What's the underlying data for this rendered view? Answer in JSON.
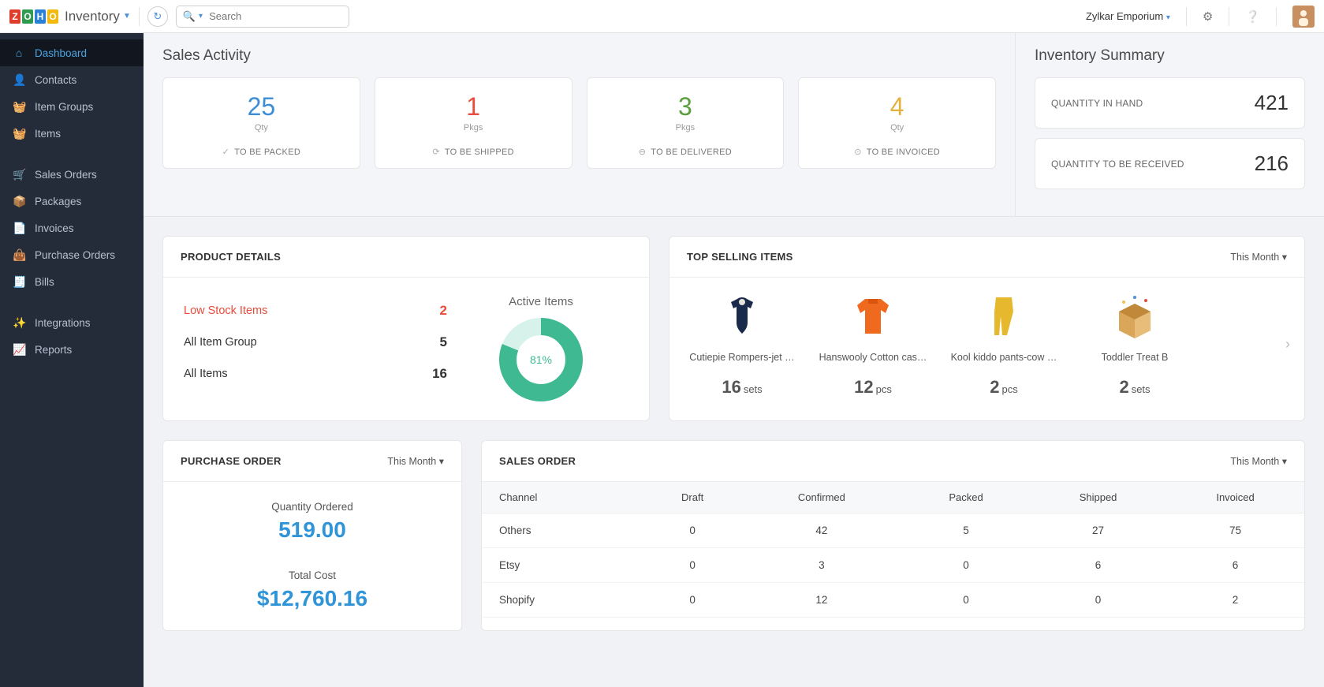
{
  "header": {
    "app_name": "Inventory",
    "search_placeholder": "Search",
    "org_name": "Zylkar Emporium"
  },
  "sidebar": {
    "items": [
      {
        "label": "Dashboard",
        "icon": "home",
        "active": true
      },
      {
        "label": "Contacts",
        "icon": "user"
      },
      {
        "label": "Item Groups",
        "icon": "basket"
      },
      {
        "label": "Items",
        "icon": "basket"
      },
      {
        "gap": true
      },
      {
        "label": "Sales Orders",
        "icon": "cart"
      },
      {
        "label": "Packages",
        "icon": "box"
      },
      {
        "label": "Invoices",
        "icon": "file"
      },
      {
        "label": "Purchase Orders",
        "icon": "bag"
      },
      {
        "label": "Bills",
        "icon": "receipt"
      },
      {
        "gap": true
      },
      {
        "label": "Integrations",
        "icon": "spark"
      },
      {
        "label": "Reports",
        "icon": "chart"
      }
    ]
  },
  "sales_activity": {
    "title": "Sales Activity",
    "cards": [
      {
        "value": "25",
        "unit": "Qty",
        "label": "TO BE PACKED",
        "color": "c-blue",
        "icon": "✓"
      },
      {
        "value": "1",
        "unit": "Pkgs",
        "label": "TO BE SHIPPED",
        "color": "c-red",
        "icon": "⟳"
      },
      {
        "value": "3",
        "unit": "Pkgs",
        "label": "TO BE DELIVERED",
        "color": "c-green",
        "icon": "⊖"
      },
      {
        "value": "4",
        "unit": "Qty",
        "label": "TO BE INVOICED",
        "color": "c-yellow",
        "icon": "⊙"
      }
    ]
  },
  "inventory_summary": {
    "title": "Inventory Summary",
    "rows": [
      {
        "label": "QUANTITY IN HAND",
        "value": "421"
      },
      {
        "label": "QUANTITY TO BE RECEIVED",
        "value": "216"
      }
    ]
  },
  "product_details": {
    "title": "PRODUCT DETAILS",
    "rows": [
      {
        "label": "Low Stock Items",
        "value": "2",
        "alert": true
      },
      {
        "label": "All Item Group",
        "value": "5"
      },
      {
        "label": "All Items",
        "value": "16"
      }
    ],
    "donut": {
      "title": "Active Items",
      "percent": 81,
      "label": "81%"
    }
  },
  "chart_data": {
    "type": "pie",
    "title": "Active Items",
    "categories": [
      "Active",
      "Inactive"
    ],
    "values": [
      81,
      19
    ]
  },
  "top_selling": {
    "title": "TOP SELLING ITEMS",
    "period": "This Month",
    "items": [
      {
        "name": "Cutiepie Rompers-jet …",
        "qty": "16",
        "unit": "sets",
        "img": "romper"
      },
      {
        "name": "Hanswooly Cotton cas…",
        "qty": "12",
        "unit": "pcs",
        "img": "sweater"
      },
      {
        "name": "Kool kiddo pants-cow …",
        "qty": "2",
        "unit": "pcs",
        "img": "pants"
      },
      {
        "name": "Toddler Treat B",
        "qty": "2",
        "unit": "sets",
        "img": "box"
      }
    ]
  },
  "purchase_order": {
    "title": "PURCHASE ORDER",
    "period": "This Month",
    "qty_label": "Quantity Ordered",
    "qty_value": "519.00",
    "cost_label": "Total Cost",
    "cost_value": "$12,760.16"
  },
  "sales_order": {
    "title": "SALES ORDER",
    "period": "This Month",
    "columns": [
      "Channel",
      "Draft",
      "Confirmed",
      "Packed",
      "Shipped",
      "Invoiced"
    ],
    "rows": [
      {
        "cells": [
          "Others",
          "0",
          "42",
          "5",
          "27",
          "75"
        ]
      },
      {
        "cells": [
          "Etsy",
          "0",
          "3",
          "0",
          "6",
          "6"
        ]
      },
      {
        "cells": [
          "Shopify",
          "0",
          "12",
          "0",
          "0",
          "2"
        ]
      }
    ]
  }
}
